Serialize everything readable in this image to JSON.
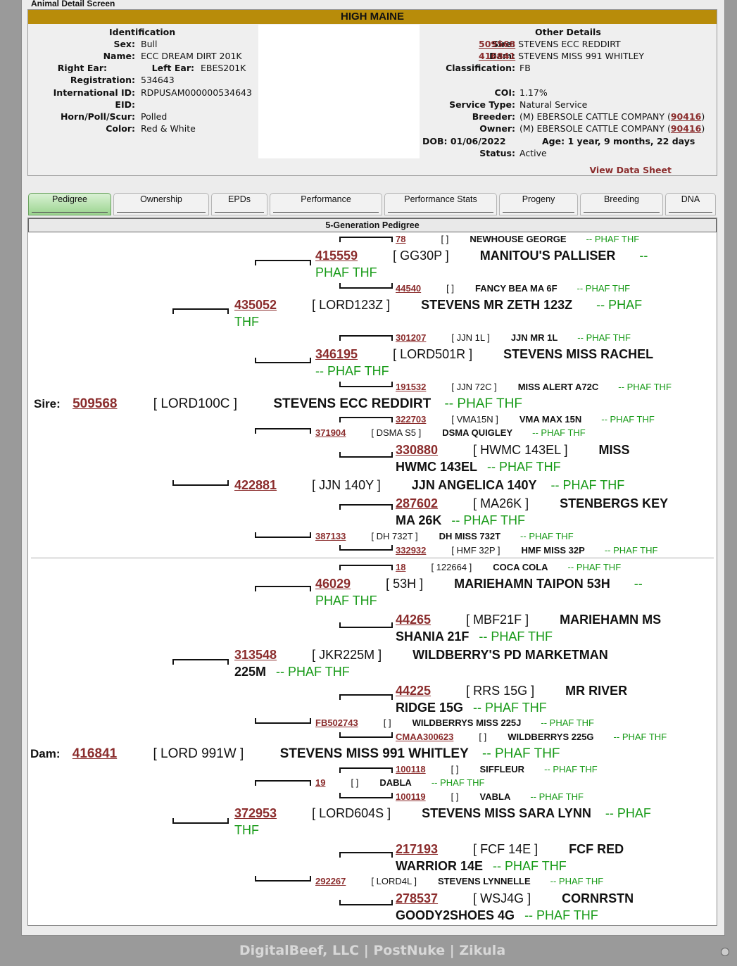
{
  "screen_title": "Animal Detail Screen",
  "herd_name": "HIGH MAINE",
  "identification": {
    "header": "Identification",
    "sex_label": "Sex:",
    "sex": "Bull",
    "name_label": "Name:",
    "name": "ECC DREAM DIRT 201K",
    "right_ear_label": "Right Ear:",
    "right_ear": "",
    "left_ear_label": "Left Ear:",
    "left_ear": "EBES201K",
    "registration_label": "Registration:",
    "registration": "534643",
    "intl_id_label": "International ID:",
    "intl_id": "RDPUSAM000000534643",
    "eid_label": "EID:",
    "eid": "",
    "horn_label": "Horn/Poll/Scur:",
    "horn": "Polled",
    "color_label": "Color:",
    "color": "Red & White"
  },
  "other_details": {
    "header": "Other Details",
    "sire_label": "Sire:",
    "sire_id": "509568",
    "sire_name": "STEVENS ECC REDDIRT",
    "dam_label": "Dam:",
    "dam_id": "416841",
    "dam_name": "STEVENS MISS 991 WHITLEY",
    "class_label": "Classification:",
    "classification": "FB",
    "coi_label": "COI:",
    "coi": "1.17%",
    "service_label": "Service Type:",
    "service": "Natural Service",
    "breeder_label": "Breeder:",
    "breeder": "(M) EBERSOLE CATTLE COMPANY (",
    "breeder_id": "90416",
    "breeder_close": ")",
    "owner_label": "Owner:",
    "owner": "(M) EBERSOLE CATTLE COMPANY (",
    "owner_id": "90416",
    "owner_close": ")",
    "dob_label": "DOB:",
    "dob": "01/06/2022",
    "age_label": "Age:",
    "age": "1 year, 9 months, 22 days",
    "status_label": "Status:",
    "status": "Active",
    "data_sheet_link": "View Data Sheet"
  },
  "tabs": [
    {
      "label": "Pedigree",
      "active": true
    },
    {
      "label": "Ownership"
    },
    {
      "label": "EPDs"
    },
    {
      "label": "Performance"
    },
    {
      "label": "Performance Stats"
    },
    {
      "label": "Progeny"
    },
    {
      "label": "Breeding"
    },
    {
      "label": "DNA"
    }
  ],
  "pedigree_title": "5-Generation Pedigree",
  "pedigree": {
    "sire": {
      "label": "Sire:",
      "id": "509568",
      "tag": "[ LORD100C ]",
      "name": "STEVENS ECC REDDIRT",
      "suffix": "-- PHAF THF"
    },
    "dam": {
      "label": "Dam:",
      "id": "416841",
      "tag": "[ LORD 991W ]",
      "name": "STEVENS MISS 991 WHITLEY",
      "suffix": "-- PHAF THF"
    },
    "rows": [
      {
        "id": "78",
        "tag": "[ ]",
        "name": "NEWHOUSE GEORGE",
        "suffix": "-- PHAF THF"
      },
      {
        "id": "415559",
        "tag": "[ GG30P ]",
        "name": "MANITOU'S PALLISER",
        "suffix": "--",
        "suffix2": "PHAF THF"
      },
      {
        "id": "44540",
        "tag": "[ ]",
        "name": "FANCY BEA MA 6F",
        "suffix": "-- PHAF THF"
      },
      {
        "id": "435052",
        "tag": "[ LORD123Z ]",
        "name": "STEVENS MR ZETH 123Z",
        "suffix": "-- PHAF",
        "suffix2": "THF"
      },
      {
        "id": "301207",
        "tag": "[ JJN 1L ]",
        "name": "JJN MR 1L",
        "suffix": "-- PHAF THF"
      },
      {
        "id": "346195",
        "tag": "[ LORD501R ]",
        "name": "STEVENS MISS RACHEL",
        "suffix2": "-- PHAF THF"
      },
      {
        "id": "191532",
        "tag": "[ JJN 72C ]",
        "name": "MISS ALERT A72C",
        "suffix": "-- PHAF THF"
      },
      {
        "id": "322703",
        "tag": "[ VMA15N ]",
        "name": "VMA MAX 15N",
        "suffix": "-- PHAF THF"
      },
      {
        "id": "371904",
        "tag": "[ DSMA S5 ]",
        "name": "DSMA QUIGLEY",
        "suffix": "-- PHAF THF"
      },
      {
        "id": "330880",
        "tag": "[ HWMC 143EL ]",
        "name": "MISS",
        "name2": "HWMC 143EL",
        "suffix": "-- PHAF THF"
      },
      {
        "id": "422881",
        "tag": "[ JJN 140Y ]",
        "name": "JJN ANGELICA 140Y",
        "suffix": "-- PHAF THF"
      },
      {
        "id": "287602",
        "tag": "[ MA26K ]",
        "name": "STENBERGS KEY",
        "name2": "MA 26K",
        "suffix": "-- PHAF THF"
      },
      {
        "id": "387133",
        "tag": "[ DH 732T ]",
        "name": "DH MISS 732T",
        "suffix": "-- PHAF THF"
      },
      {
        "id": "332932",
        "tag": "[ HMF 32P ]",
        "name": "HMF MISS 32P",
        "suffix": "-- PHAF THF"
      },
      {
        "id": "18",
        "tag": "[ 122664 ]",
        "name": "COCA COLA",
        "suffix": "-- PHAF THF"
      },
      {
        "id": "46029",
        "tag": "[ 53H ]",
        "name": "MARIEHAMN TAIPON 53H",
        "suffix": "--",
        "suffix2": "PHAF THF"
      },
      {
        "id": "44265",
        "tag": "[ MBF21F ]",
        "name": "MARIEHAMN MS",
        "name2": "SHANIA 21F",
        "suffix": "-- PHAF THF"
      },
      {
        "id": "313548",
        "tag": "[ JKR225M ]",
        "name": "WILDBERRY'S PD MARKETMAN",
        "name2": "225M",
        "suffix": "-- PHAF THF"
      },
      {
        "id": "44225",
        "tag": "[ RRS 15G ]",
        "name": "MR RIVER",
        "name2": "RIDGE 15G",
        "suffix": "-- PHAF THF"
      },
      {
        "id": "FB502743",
        "tag": "[ ]",
        "name": "WILDBERRYS MISS 225J",
        "suffix": "-- PHAF THF"
      },
      {
        "id": "CMAA300623",
        "tag": "[ ]",
        "name": "WILDBERRYS 225G",
        "suffix": "-- PHAF THF"
      },
      {
        "id": "100118",
        "tag": "[ ]",
        "name": "SIFFLEUR",
        "suffix": "-- PHAF THF"
      },
      {
        "id": "19",
        "tag": "[ ]",
        "name": "DABLA",
        "suffix": "-- PHAF THF"
      },
      {
        "id": "100119",
        "tag": "[ ]",
        "name": "VABLA",
        "suffix": "-- PHAF THF"
      },
      {
        "id": "372953",
        "tag": "[ LORD604S ]",
        "name": "STEVENS MISS SARA LYNN",
        "suffix": "-- PHAF",
        "suffix2": "THF"
      },
      {
        "id": "217193",
        "tag": "[ FCF 14E ]",
        "name": "FCF RED",
        "name2": "WARRIOR 14E",
        "suffix": "-- PHAF THF"
      },
      {
        "id": "292267",
        "tag": "[ LORD4L ]",
        "name": "STEVENS LYNNELLE",
        "suffix": "-- PHAF THF"
      },
      {
        "id": "278537",
        "tag": "[ WSJ4G ]",
        "name": "CORNRSTN",
        "name2": "GOODY2SHOES 4G",
        "suffix": "-- PHAF THF"
      }
    ]
  },
  "footer": {
    "company": "DigitalBeef, LLC",
    "sep": "|",
    "link1": "PostNuke",
    "link2": "Zikula"
  }
}
